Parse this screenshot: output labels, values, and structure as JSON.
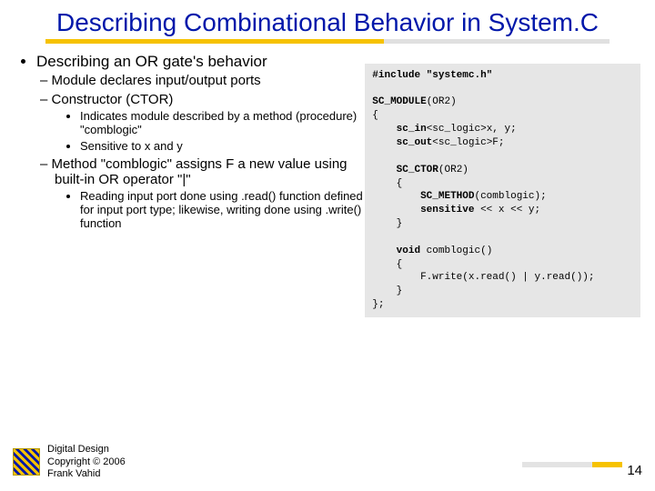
{
  "title": "Describing Combinational Behavior in System.C",
  "bullets": {
    "l1": "Describing an OR gate's behavior",
    "l2a": "Module declares input/output ports",
    "l2b": "Constructor (CTOR)",
    "l3a": "Indicates module described by a method (procedure) \"comblogic\"",
    "l3b": "Sensitive to x and y",
    "l2c": "Method \"comblogic\" assigns F a new value using built-in OR operator \"|\"",
    "l3c": "Reading input port done using .read() function defined for input port type; likewise, writing done using .write() function"
  },
  "code": {
    "line1": "#include \"systemc.h\"",
    "line2": "SC_MODULE",
    "line2b": "(OR2)",
    "line3": "{",
    "line4a": "    sc_in",
    "line4b": "<sc_logic>x, y;",
    "line5a": "    sc_out",
    "line5b": "<sc_logic>F;",
    "line6a": "    SC_CTOR",
    "line6b": "(OR2)",
    "line7": "    {",
    "line8a": "        SC_METHOD",
    "line8b": "(comblogic);",
    "line9a": "        sensitive",
    "line9b": " << x << y;",
    "line10": "    }",
    "line11a": "    void",
    "line11b": " comblogic()",
    "line12": "    {",
    "line13": "        F.write(x.read() | y.read());",
    "line14": "    }",
    "line15": "};"
  },
  "footer": {
    "l1": "Digital Design",
    "l2": "Copyright © 2006",
    "l3": "Frank Vahid"
  },
  "page": "14"
}
